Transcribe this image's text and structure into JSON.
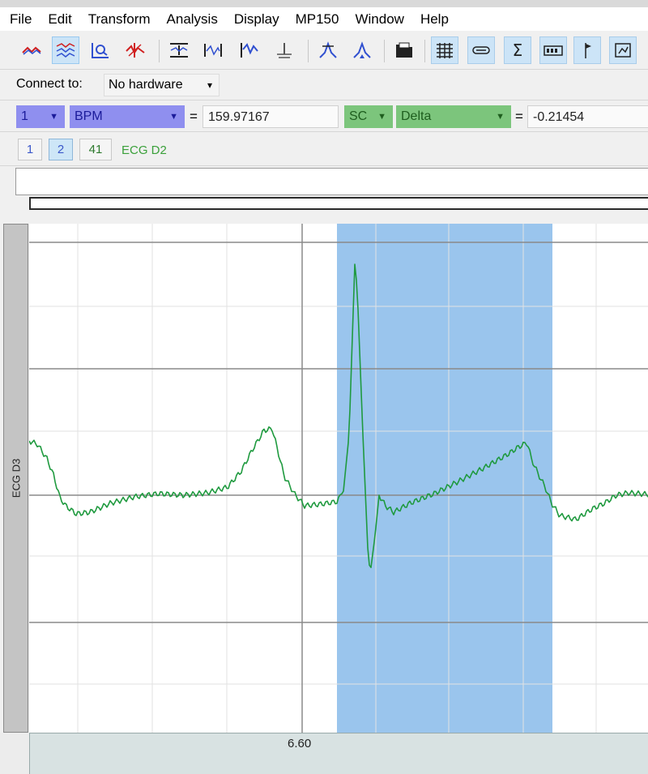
{
  "menu": [
    "File",
    "Edit",
    "Transform",
    "Analysis",
    "Display",
    "MP150",
    "Window",
    "Help"
  ],
  "toolbar": {
    "buttons": [
      {
        "name": "arrow-tool-icon",
        "pressed": false
      },
      {
        "name": "selection-tool-icon",
        "pressed": true
      },
      {
        "name": "zoom-tool-icon",
        "pressed": false
      },
      {
        "name": "pencil-tool-icon",
        "pressed": false
      },
      {
        "name": "autoscale-horizontal-icon",
        "pressed": false
      },
      {
        "name": "autoscale-waveforms-icon",
        "pressed": false
      },
      {
        "name": "overlap-segments-icon",
        "pressed": false
      },
      {
        "name": "split-segments-icon",
        "pressed": false
      },
      {
        "name": "find-peak-icon",
        "pressed": false
      },
      {
        "name": "find-cycle-icon",
        "pressed": false
      },
      {
        "name": "open-folder-icon",
        "pressed": false
      },
      {
        "name": "show-grid-icon",
        "pressed": false
      },
      {
        "name": "show-markers-icon",
        "pressed": false
      },
      {
        "name": "sigma-stats-icon",
        "pressed": false
      },
      {
        "name": "data-view-icon",
        "pressed": false
      },
      {
        "name": "event-flag-icon",
        "pressed": false
      },
      {
        "name": "journal-icon",
        "pressed": false
      }
    ]
  },
  "connect": {
    "label": "Connect to:",
    "value": "No hardware"
  },
  "measurements": [
    {
      "channel": "1",
      "type": "BPM",
      "value": "159.97167"
    },
    {
      "channel": "SC",
      "type": "Delta",
      "value": "-0.21454"
    }
  ],
  "channels": {
    "buttons": [
      "1",
      "2",
      "41"
    ],
    "selected": "2",
    "label": "ECG D2"
  },
  "graph": {
    "channel_label": "ECG D3",
    "time_tick": "6.60",
    "trace_color": "#1f9a3f",
    "selection_color": "#3d8fdd"
  }
}
